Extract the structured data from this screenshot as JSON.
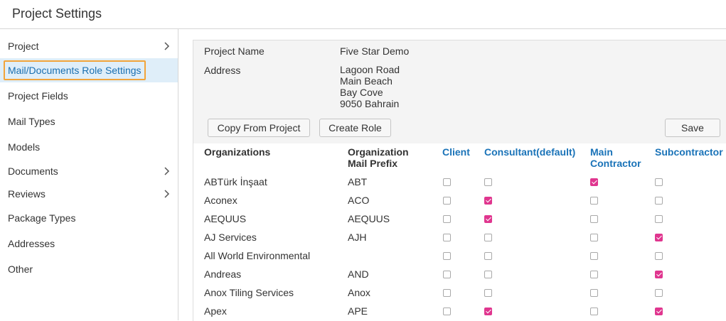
{
  "header": {
    "title": "Project Settings"
  },
  "sidebar": {
    "items": [
      {
        "label": "Project",
        "chevron": true
      },
      {
        "label": "Mail/Documents Role Settings",
        "chevron": false,
        "active": true
      },
      {
        "label": "Project Fields",
        "chevron": false
      },
      {
        "label": "Mail Types",
        "chevron": false
      },
      {
        "label": "Models",
        "chevron": false
      },
      {
        "label": "Documents",
        "chevron": true
      },
      {
        "label": "Reviews",
        "chevron": true
      },
      {
        "label": "Package Types",
        "chevron": false
      },
      {
        "label": "Addresses",
        "chevron": false
      },
      {
        "label": "Other",
        "chevron": false
      }
    ]
  },
  "project": {
    "name_label": "Project Name",
    "name_value": "Five Star Demo",
    "address_label": "Address",
    "address_lines": [
      "Lagoon Road",
      "Main Beach",
      "Bay Cove",
      "9050 Bahrain"
    ]
  },
  "toolbar": {
    "copy_label": "Copy From Project",
    "create_label": "Create Role",
    "save_label": "Save"
  },
  "table": {
    "headers": {
      "organizations": "Organizations",
      "prefix_line1": "Organization",
      "prefix_line2": "Mail Prefix",
      "client": "Client",
      "consultant": "Consultant(default)",
      "main_line1": "Main",
      "main_line2": "Contractor",
      "subcontractor": "Subcontractor"
    },
    "rows": [
      {
        "org": "ABTürk İnşaat",
        "prefix": "ABT",
        "roles": [
          false,
          false,
          true,
          false
        ]
      },
      {
        "org": "Aconex",
        "prefix": "ACO",
        "roles": [
          false,
          true,
          false,
          false
        ]
      },
      {
        "org": "AEQUUS",
        "prefix": "AEQUUS",
        "roles": [
          false,
          true,
          false,
          false
        ]
      },
      {
        "org": "AJ Services",
        "prefix": "AJH",
        "roles": [
          false,
          false,
          false,
          true
        ]
      },
      {
        "org": "All World Environmental",
        "prefix": "",
        "roles": [
          false,
          false,
          false,
          false
        ]
      },
      {
        "org": "Andreas",
        "prefix": "AND",
        "roles": [
          false,
          false,
          false,
          true
        ]
      },
      {
        "org": "Anox Tiling Services",
        "prefix": "Anox",
        "roles": [
          false,
          false,
          false,
          false
        ]
      },
      {
        "org": "Apex",
        "prefix": "APE",
        "roles": [
          false,
          true,
          false,
          true
        ]
      }
    ]
  },
  "colors": {
    "accent_blue": "#1a73b8",
    "checked_pink": "#e0368f",
    "highlight_orange": "#f2a43a",
    "active_bg": "#dfeef9"
  }
}
